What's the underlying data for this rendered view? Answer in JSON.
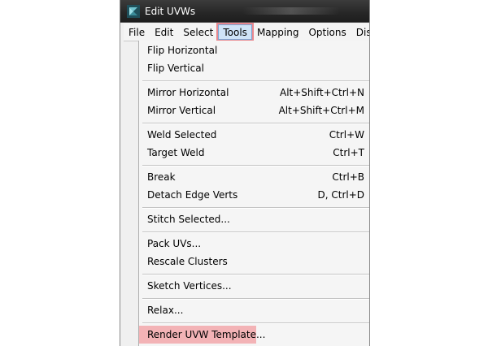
{
  "window": {
    "title": "Edit UVWs"
  },
  "menubar": {
    "items": [
      {
        "label": "File"
      },
      {
        "label": "Edit"
      },
      {
        "label": "Select"
      },
      {
        "label": "Tools"
      },
      {
        "label": "Mapping"
      },
      {
        "label": "Options"
      },
      {
        "label": "Disp"
      }
    ],
    "active": "Tools"
  },
  "tools_menu": {
    "items": [
      {
        "label": "Flip Horizontal",
        "shortcut": ""
      },
      {
        "label": "Flip Vertical",
        "shortcut": ""
      },
      {
        "label": "Mirror Horizontal",
        "shortcut": "Alt+Shift+Ctrl+N"
      },
      {
        "label": "Mirror Vertical",
        "shortcut": "Alt+Shift+Ctrl+M"
      },
      {
        "label": "Weld Selected",
        "shortcut": "Ctrl+W"
      },
      {
        "label": "Target Weld",
        "shortcut": "Ctrl+T"
      },
      {
        "label": "Break",
        "shortcut": "Ctrl+B"
      },
      {
        "label": "Detach Edge Verts",
        "shortcut": "D, Ctrl+D"
      },
      {
        "label": "Stitch Selected...",
        "shortcut": ""
      },
      {
        "label": "Pack UVs...",
        "shortcut": ""
      },
      {
        "label": "Rescale Clusters",
        "shortcut": ""
      },
      {
        "label": "Sketch Vertices...",
        "shortcut": ""
      },
      {
        "label": "Relax...",
        "shortcut": ""
      },
      {
        "label": "Render UVW Template...",
        "shortcut": ""
      }
    ]
  },
  "colors": {
    "highlight": "#f3b3b6",
    "titlebar": "#262626"
  }
}
